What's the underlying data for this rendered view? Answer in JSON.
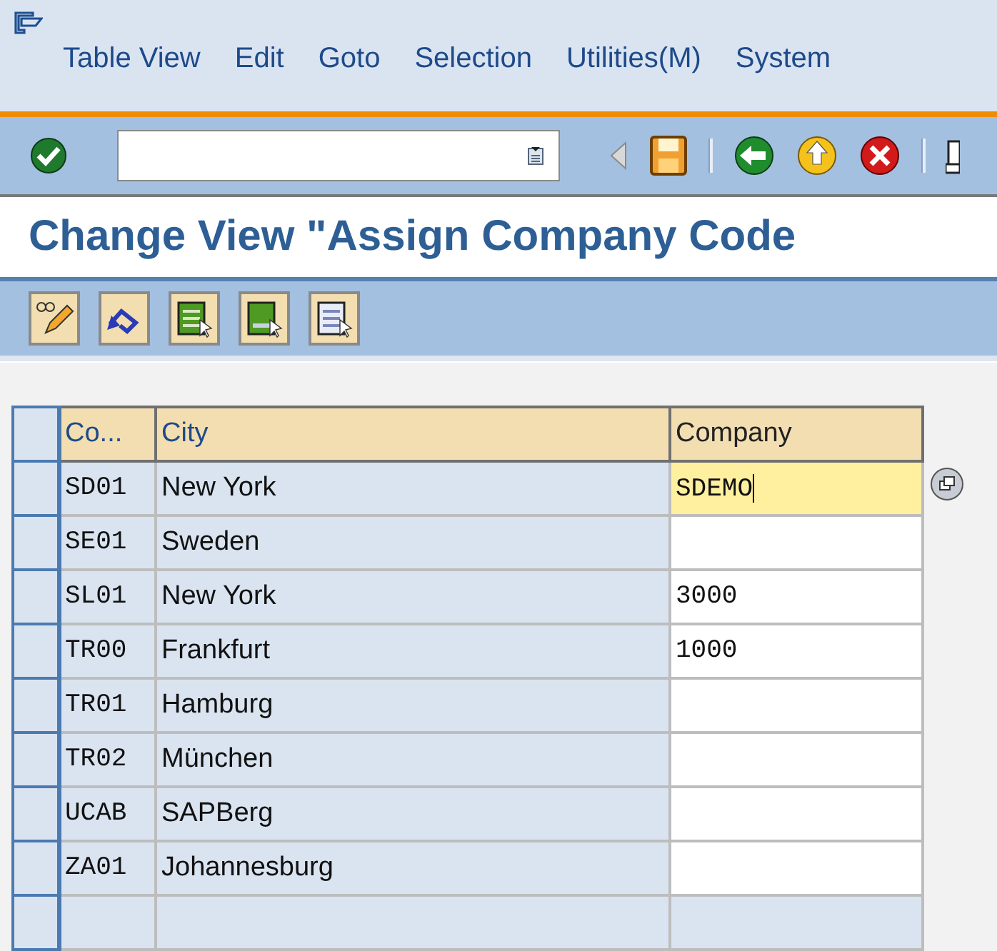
{
  "menu_bar": [
    "Table View",
    "Edit",
    "Goto",
    "Selection",
    "Utilities(M)",
    "System"
  ],
  "title": "Change View \"Assign Company Code",
  "table": {
    "columns": [
      "Co...",
      "City",
      "Company"
    ],
    "rows": [
      {
        "code": "SD01",
        "city": "New York",
        "company": "SDEMO",
        "editable": true,
        "focused": true
      },
      {
        "code": "SE01",
        "city": "Sweden",
        "editable": true,
        "focused": false
      },
      {
        "code": "SL01",
        "city": "New York",
        "company": "3000",
        "editable": true,
        "focused": false
      },
      {
        "code": "TR00",
        "city": "Frankfurt",
        "company": "1000",
        "editable": true,
        "focused": false
      },
      {
        "code": "TR01",
        "city": "Hamburg",
        "editable": true,
        "focused": false
      },
      {
        "code": "TR02",
        "city": "München",
        "editable": true,
        "focused": false
      },
      {
        "code": "UCAB",
        "city": "SAPBerg",
        "editable": true,
        "focused": false
      },
      {
        "code": "ZA01",
        "city": "Johannesburg",
        "editable": true,
        "focused": false
      },
      {
        "editable": false,
        "focused": false
      }
    ]
  }
}
